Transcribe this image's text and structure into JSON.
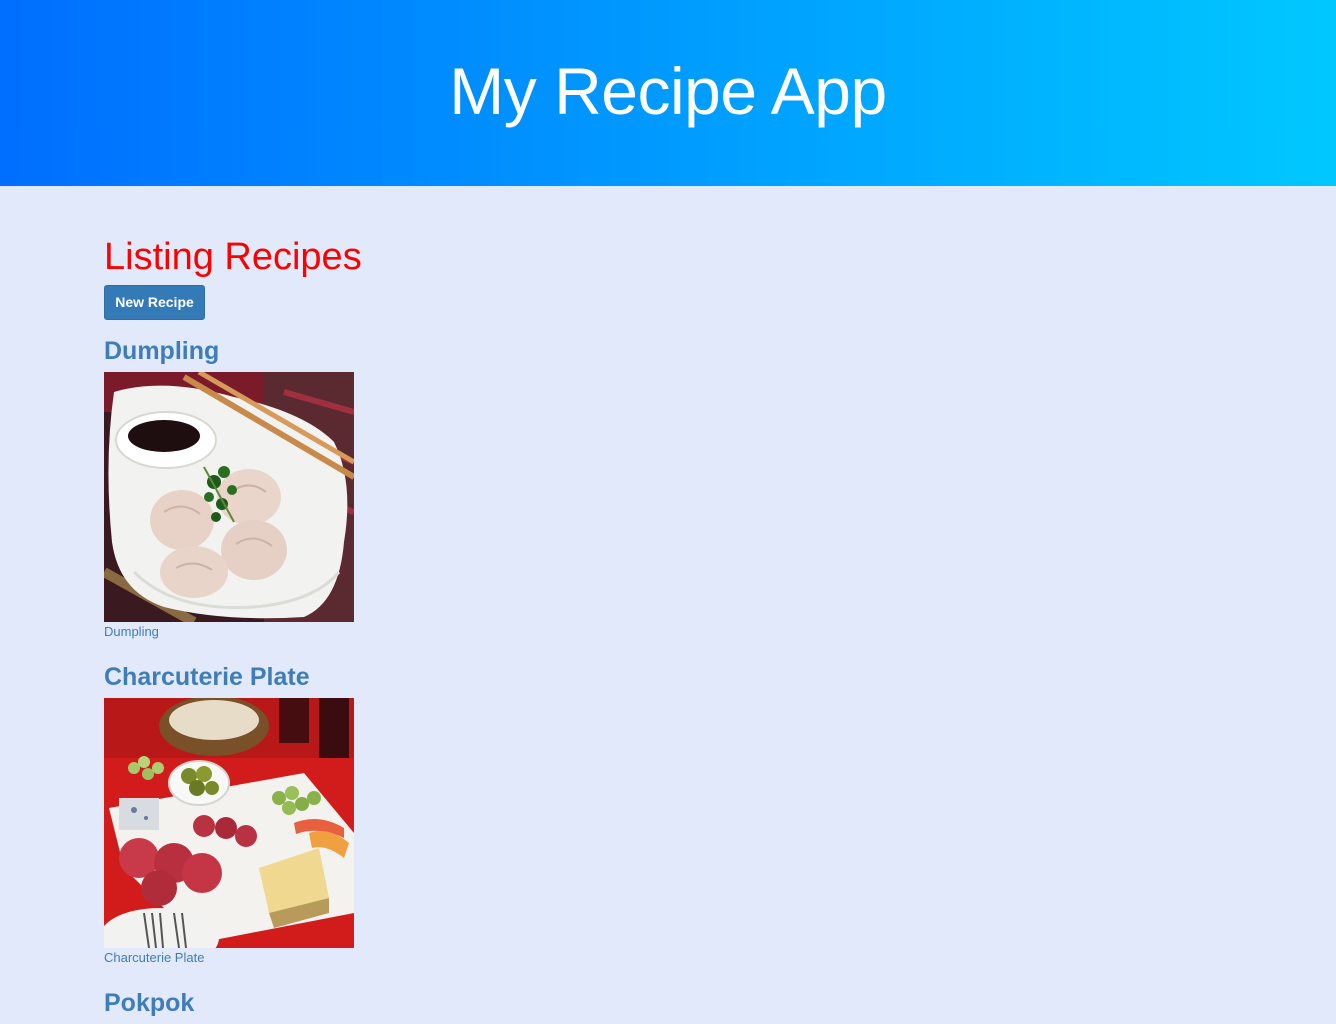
{
  "header": {
    "title": "My Recipe App"
  },
  "main": {
    "title": "Listing Recipes",
    "new_button": "New Recipe",
    "recipes": [
      {
        "title": "Dumpling",
        "caption": "Dumpling"
      },
      {
        "title": "Charcuterie Plate",
        "caption": "Charcuterie Plate"
      },
      {
        "title": "Pokpok",
        "caption": ""
      }
    ]
  },
  "colors": {
    "header_gradient_start": "#006eff",
    "header_gradient_end": "#00c8ff",
    "page_background": "#e1e9fb",
    "title_red": "#ff0000",
    "link_blue": "#3f7db8",
    "button_blue": "#337ab7"
  }
}
